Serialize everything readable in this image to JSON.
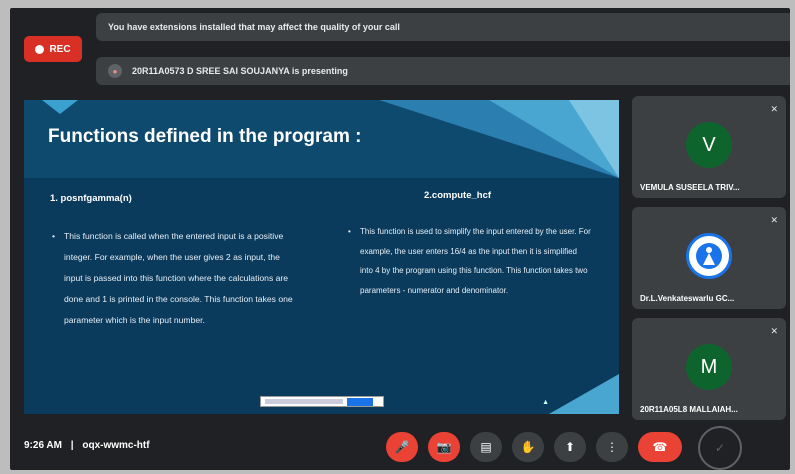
{
  "recording": {
    "label": "REC"
  },
  "banners": {
    "extensions": "You have extensions installed that may affect the quality of your call",
    "presenting": "20R11A0573 D SREE SAI SOUJANYA is presenting"
  },
  "slide": {
    "title": "Functions defined in the program :",
    "sections": [
      {
        "heading": "1. posnfgamma(n)",
        "body": "This function is called when the entered input is a positive integer. For example, when the user gives 2 as input, the input is passed into this function where the calculations are done and 1 is printed in the console. This function takes one parameter which is the input number."
      },
      {
        "heading": "2.compute_hcf",
        "body": "This function is used to simplify the input entered by the user. For example, the user enters 16/4 as the input then it is simplified into 4 by the program using this function. This function takes two parameters - numerator and denominator."
      }
    ]
  },
  "participants": [
    {
      "initial": "V",
      "name": "VEMULA SUSEELA TRIV...",
      "avatar": "letter"
    },
    {
      "initial": "",
      "name": "Dr.L.Venkateswarlu GC...",
      "avatar": "logo"
    },
    {
      "initial": "M",
      "name": "20R11A05L8 MALLAIAH...",
      "avatar": "letter"
    }
  ],
  "meeting": {
    "time": "9:26 AM",
    "separator": "|",
    "code": "oqx-wwmc-htf"
  },
  "controls": [
    {
      "name": "mic-off",
      "icon": "🎤",
      "style": "red"
    },
    {
      "name": "camera-off",
      "icon": "📷",
      "style": "red"
    },
    {
      "name": "captions",
      "icon": "▤",
      "style": "grey"
    },
    {
      "name": "raise-hand",
      "icon": "✋",
      "style": "grey"
    },
    {
      "name": "present",
      "icon": "⬆",
      "style": "grey"
    },
    {
      "name": "more-options",
      "icon": "⋮",
      "style": "grey"
    },
    {
      "name": "leave-call",
      "icon": "☎",
      "style": "red"
    }
  ]
}
